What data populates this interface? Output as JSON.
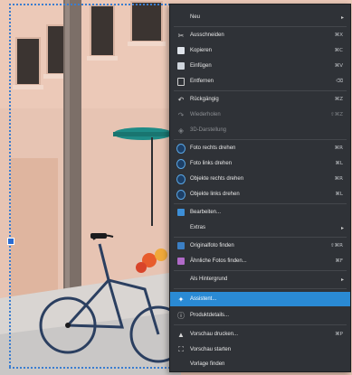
{
  "photo": {
    "alt": ""
  },
  "menu": {
    "items": [
      {
        "label": "Neu",
        "shortcut": "",
        "icon": "none",
        "submenu": true
      },
      {
        "label": "Ausschneiden",
        "shortcut": "⌘X",
        "icon": "scissors-icon"
      },
      {
        "label": "Kopieren",
        "shortcut": "⌘C",
        "icon": "copy-icon"
      },
      {
        "label": "Einfügen",
        "shortcut": "⌘V",
        "icon": "paste-icon"
      },
      {
        "label": "Entfernen",
        "shortcut": "⌫",
        "icon": "trash-icon"
      },
      {
        "label": "Rückgängig",
        "shortcut": "⌘Z",
        "icon": "undo-icon"
      },
      {
        "label": "Wiederholen",
        "shortcut": "⇧⌘Z",
        "icon": "redo-icon",
        "disabled": true
      },
      {
        "label": "3D-Darstellung",
        "shortcut": "",
        "icon": "3d-icon",
        "disabled": true
      },
      {
        "label": "Foto rechts drehen",
        "shortcut": "⌘R",
        "icon": "rotate-right-icon"
      },
      {
        "label": "Foto links drehen",
        "shortcut": "⌘L",
        "icon": "rotate-left-icon"
      },
      {
        "label": "Objekte rechts drehen",
        "shortcut": "⌘R",
        "icon": "rotate-objects-right-icon"
      },
      {
        "label": "Objekte links drehen",
        "shortcut": "⌘L",
        "icon": "rotate-objects-left-icon"
      },
      {
        "label": "Bearbeiten...",
        "shortcut": "",
        "icon": "edit-icon"
      },
      {
        "label": "Extras",
        "shortcut": "",
        "icon": "none",
        "submenu": true
      },
      {
        "label": "Originalfoto finden",
        "shortcut": "⇧⌘R",
        "icon": "find-original-icon"
      },
      {
        "label": "Ähnliche Fotos finden...",
        "shortcut": "⌘F",
        "icon": "find-similar-icon"
      },
      {
        "label": "Als Hintergrund",
        "shortcut": "",
        "icon": "none",
        "submenu": true
      },
      {
        "label": "Assistent...",
        "shortcut": "",
        "icon": "assistant-icon",
        "highlighted": true
      },
      {
        "label": "Produktdetails...",
        "shortcut": "",
        "icon": "info-icon"
      },
      {
        "label": "Vorschau drucken...",
        "shortcut": "⌘P",
        "icon": "print-icon"
      },
      {
        "label": "Vorschau starten",
        "shortcut": "",
        "icon": "slideshow-icon"
      },
      {
        "label": "Vorlage finden",
        "shortcut": "",
        "icon": "none"
      }
    ]
  },
  "colors": {
    "menu_bg": "#2f3237",
    "highlight": "#2a8ad4",
    "wall": "#e8c3b1",
    "awning": "#1f8b86"
  }
}
